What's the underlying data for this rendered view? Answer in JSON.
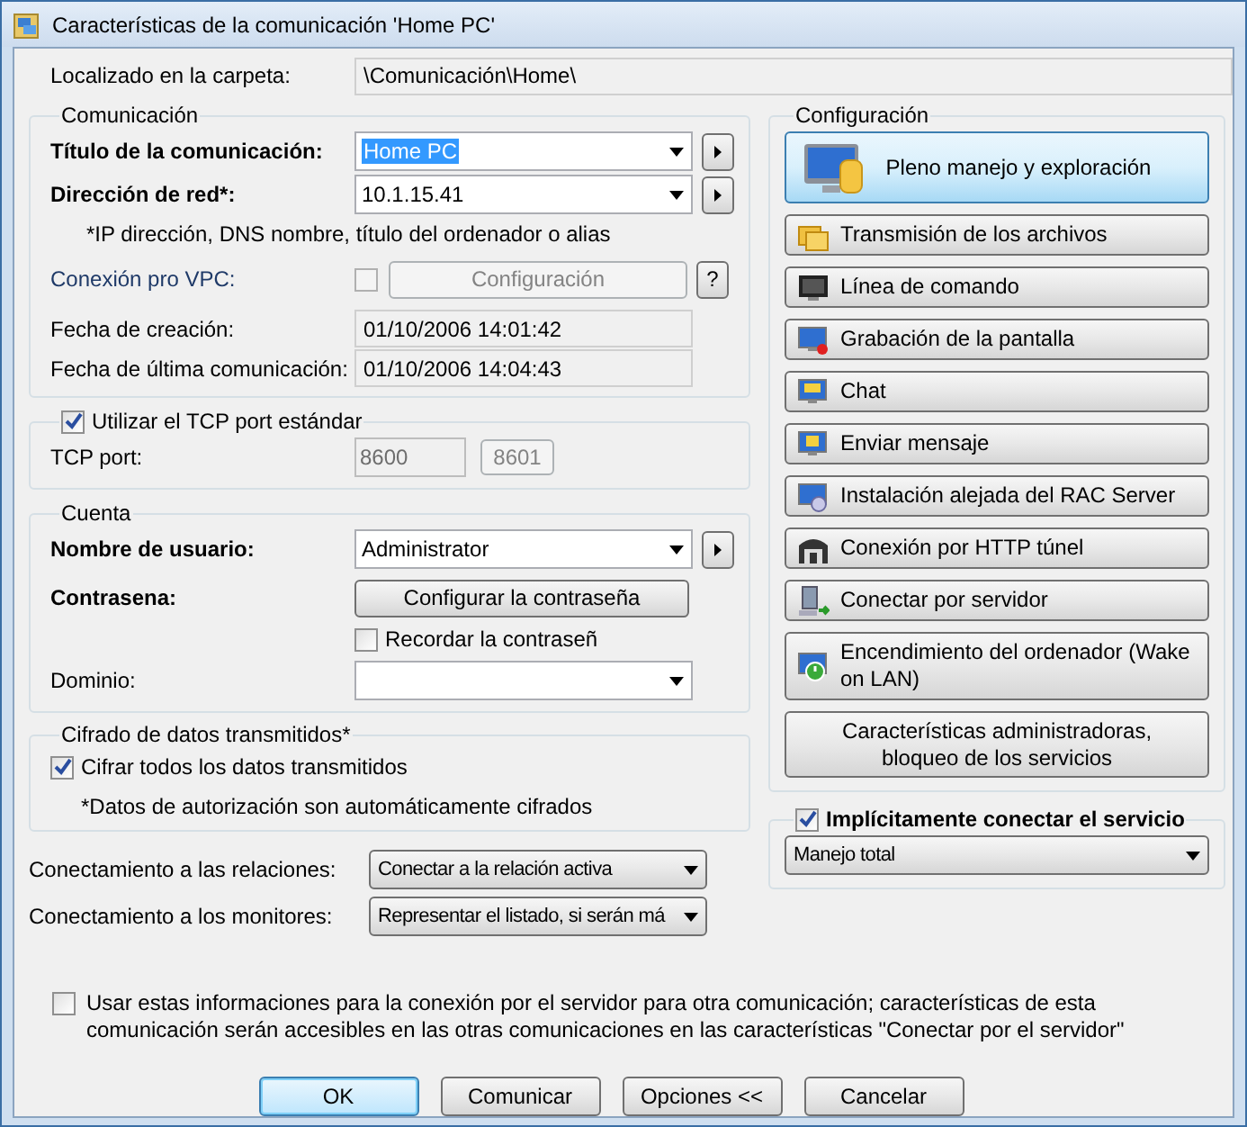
{
  "window": {
    "title": "Características de la comunicación 'Home PC'"
  },
  "location": {
    "label": "Localizado en la carpeta:",
    "value": "\\Comunicación\\Home\\"
  },
  "communication": {
    "legend": "Comunicación",
    "title": {
      "label": "Título de la comunicación:",
      "value": "Home PC",
      "required": true,
      "selected": true
    },
    "address": {
      "label": "Dirección de red*:",
      "value": "10.1.15.41",
      "required": true,
      "selected": false
    },
    "hint": "*IP dirección, DNS nombre, título del ordenador o alias",
    "vpc": {
      "label": "Conexión pro VPC:",
      "checked": false,
      "button": "Configuración",
      "help": "?"
    },
    "created": {
      "label": "Fecha de creación:",
      "value": "01/10/2006 14:01:42"
    },
    "last": {
      "label": "Fecha de última comunicación:",
      "value": "01/10/2006 14:04:43"
    }
  },
  "tcp": {
    "label": "Utilizar el TCP port estándar",
    "checked": true,
    "port_label": "TCP port:",
    "port": "8600",
    "alt_port": "8601"
  },
  "account": {
    "legend": "Cuenta",
    "user": {
      "label": "Nombre de usuario:",
      "value": "Administrator",
      "required": true
    },
    "password": {
      "label": "Contrasena:",
      "button": "Configurar la contraseña",
      "required": true
    },
    "remember": {
      "label": "Recordar la contraseñ",
      "checked": false
    },
    "domain": {
      "label": "Dominio:",
      "required": false
    }
  },
  "encryption": {
    "legend": "Cifrado de datos transmitidos*",
    "label": "Cifrar todos los datos transmitidos",
    "checked": true,
    "note": "*Datos de autorización son automáticamente cifrados"
  },
  "relations": {
    "label": "Conectamiento a las relaciones:",
    "value": "Conectar a la relación activa"
  },
  "monitors": {
    "label": "Conectamiento a los monitores:",
    "value": "Representar el listado, si serán má"
  },
  "server_share": {
    "label": "Usar estas informaciones para la conexión por el servidor para otra comunicación; características de esta comunicación serán accesibles en las otras comunicaciones en las características \"Conectar por el servidor\"",
    "checked": false
  },
  "configuration": {
    "legend": "Configuración",
    "items": [
      {
        "label": "Pleno manejo y exploración",
        "kind": "large",
        "selected": true
      },
      {
        "label": "Transmisión de los archivos",
        "kind": "icon",
        "selected": false
      },
      {
        "label": "Línea de comando",
        "kind": "icon",
        "selected": false
      },
      {
        "label": "Grabación de la pantalla",
        "kind": "icon",
        "selected": false
      },
      {
        "label": "Chat",
        "kind": "icon",
        "selected": false
      },
      {
        "label": "Enviar mensaje",
        "kind": "icon",
        "selected": false
      },
      {
        "label": "Instalación alejada del RAC Server",
        "kind": "icon",
        "selected": false
      },
      {
        "label": "Conexión por HTTP túnel",
        "kind": "icon",
        "selected": false
      },
      {
        "label": "Conectar por servidor",
        "kind": "icon",
        "selected": false
      },
      {
        "label": "Encendimiento del ordenador (Wake on LAN)",
        "kind": "icon",
        "selected": false
      },
      {
        "label": "Características administradoras,\nbloqueo de los servicios",
        "kind": "plain",
        "selected": false
      }
    ]
  },
  "default_service": {
    "label": "Implícitamente conectar el servicio",
    "checked": true,
    "value": "Manejo total"
  },
  "buttons": [
    {
      "label": "OK",
      "default": true
    },
    {
      "label": "Comunicar",
      "default": false
    },
    {
      "label": "Opciones <<",
      "default": false
    },
    {
      "label": "Cancelar",
      "default": false
    }
  ]
}
